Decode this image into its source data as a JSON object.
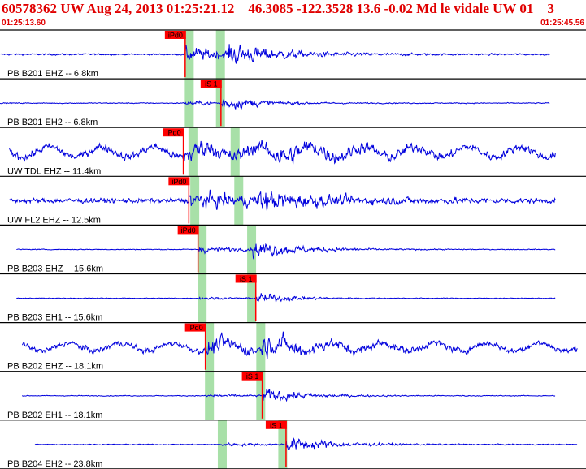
{
  "header": {
    "title": "60578362 UW Aug 24, 2013 01:25:21.12    46.3085 -122.3528 13.6 -0.02 Md le vidale UW 01    3",
    "time_start": "01:25:13.60",
    "time_end": "01:25:45.56"
  },
  "colors": {
    "trace": "#0000dd",
    "pick": "#ff0000",
    "pick_label_text": "#000000",
    "window": "#a8e0a8",
    "divider": "#000000",
    "title": "#e00000"
  },
  "chart_data": {
    "type": "line",
    "title": "60578362 UW Aug 24, 2013 01:25:21.12    46.3085 -122.3528 13.6 -0.02 Md le vidale UW 01    3",
    "x_range": [
      "01:25:13.60",
      "01:25:45.56"
    ],
    "x_range_seconds": [
      0,
      31.96
    ],
    "series": [
      {
        "name": "PB B201 EHZ -- 6.8km",
        "pick_label": "iPd0",
        "pick_time": 10.1,
        "p_time": 10.1,
        "s_time": 12.4,
        "trace_start": 0.0,
        "trace_end": 30.0,
        "noise": 0.1,
        "p_amp": 0.85,
        "s_amp": 0.9,
        "decay": 3.0
      },
      {
        "name": "PB B201 EH2 -- 6.8km",
        "pick_label": "iS 1",
        "pick_time": 12.05,
        "p_time": 10.1,
        "s_time": 12.05,
        "trace_start": 0.0,
        "trace_end": 30.0,
        "noise": 0.06,
        "p_amp": 0.25,
        "s_amp": 0.8,
        "decay": 2.0
      },
      {
        "name": "UW TDL EHZ -- 11.4km",
        "pick_label": "iPd0",
        "pick_time": 10.0,
        "p_time": 10.0,
        "s_time": 14.5,
        "trace_start": 0.5,
        "trace_end": 30.3,
        "noise": 0.45,
        "p_amp": 0.8,
        "s_amp": 0.7,
        "decay": 4.0
      },
      {
        "name": "UW FL2 EHZ -- 12.5km",
        "pick_label": "iPd0",
        "pick_time": 10.3,
        "p_time": 10.3,
        "s_time": 14.0,
        "trace_start": 0.5,
        "trace_end": 30.3,
        "noise": 0.3,
        "p_amp": 0.8,
        "s_amp": 0.75,
        "decay": 4.0
      },
      {
        "name": "PB B203 EHZ -- 15.6km",
        "pick_label": "iPd0",
        "pick_time": 10.8,
        "p_time": 10.8,
        "s_time": 13.8,
        "trace_start": 0.9,
        "trace_end": 30.3,
        "noise": 0.05,
        "p_amp": 0.4,
        "s_amp": 0.95,
        "decay": 2.5
      },
      {
        "name": "PB B203 EH1 -- 15.6km",
        "pick_label": "iS 1",
        "pick_time": 13.95,
        "p_time": 10.8,
        "s_time": 13.95,
        "trace_start": 0.9,
        "trace_end": 30.3,
        "noise": 0.04,
        "p_amp": 0.15,
        "s_amp": 0.6,
        "decay": 2.0
      },
      {
        "name": "PB B202 EHZ -- 18.1km",
        "pick_label": "iPd0",
        "pick_time": 11.2,
        "p_time": 11.2,
        "s_time": 14.3,
        "trace_start": 1.2,
        "trace_end": 31.5,
        "noise": 0.35,
        "p_amp": 0.7,
        "s_amp": 0.8,
        "decay": 3.0
      },
      {
        "name": "PB B202 EH1 -- 18.1km",
        "pick_label": "iS 1",
        "pick_time": 14.3,
        "p_time": 11.2,
        "s_time": 14.3,
        "trace_start": 1.2,
        "trace_end": 30.3,
        "noise": 0.05,
        "p_amp": 0.2,
        "s_amp": 0.85,
        "decay": 2.2
      },
      {
        "name": "PB B204 EH2 -- 23.8km",
        "pick_label": "iS 1",
        "pick_time": 15.6,
        "p_time": 12.1,
        "s_time": 15.6,
        "trace_start": 1.9,
        "trace_end": 31.5,
        "noise": 0.06,
        "p_amp": 0.2,
        "s_amp": 0.85,
        "decay": 2.5
      }
    ],
    "theoretical_windows": [
      {
        "trace": 0,
        "p": 10.3,
        "s": 12.0
      },
      {
        "trace": 1,
        "p": 10.3,
        "s": 12.0
      },
      {
        "trace": 2,
        "p": 10.5,
        "s": 12.8
      },
      {
        "trace": 3,
        "p": 10.6,
        "s": 13.0
      },
      {
        "trace": 4,
        "p": 11.0,
        "s": 13.7
      },
      {
        "trace": 5,
        "p": 11.0,
        "s": 13.7
      },
      {
        "trace": 6,
        "p": 11.4,
        "s": 14.2
      },
      {
        "trace": 7,
        "p": 11.4,
        "s": 14.2
      },
      {
        "trace": 8,
        "p": 12.1,
        "s": 15.4
      }
    ],
    "grid": false,
    "legend": "none"
  }
}
